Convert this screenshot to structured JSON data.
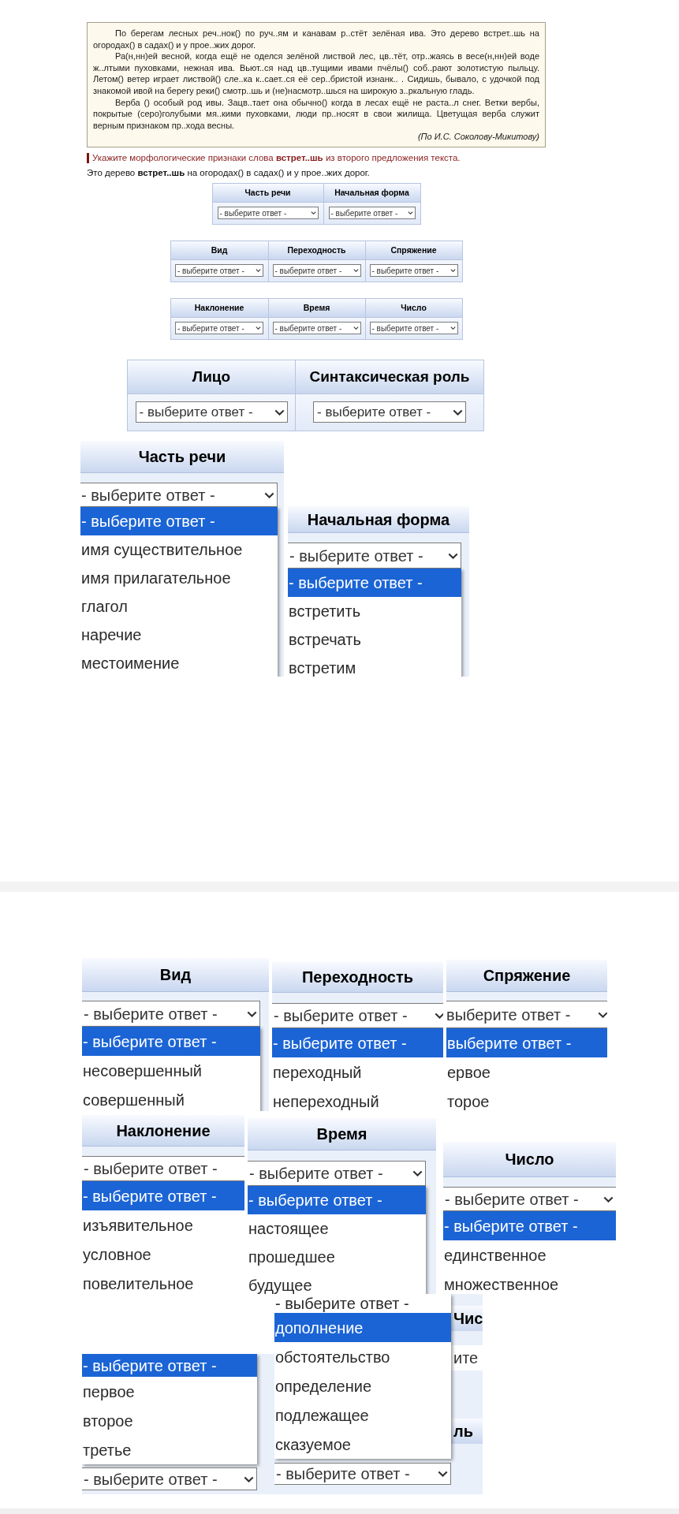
{
  "passage": {
    "paragraphs": [
      "По берегам лесных реч..нок() по руч..ям и канавам р..стёт зелёная ива. Это дерево встрет..шь на огородах() в садах() и у прое..жих дорог.",
      "Ра(н,нн)ей весной, когда ещё не оделся зелёной листвой лес, цв..тёт, отр..жаясь в весе(н,нн)ей воде ж..лтыми пуховками, нежная ива. Вьют..ся над цв..тущими ивами пчёлы() соб..рают золотистую пыльцу. Летом() ветер играет листвой() сле..ка к..сает..ся её сер..бристой изнанк.. . Сидишь, бывало, с удочкой под знакомой ивой на берегу реки() смотр..шь и (не)насмотр..шься на широкую з..ркальную гладь.",
      "Верба () особый род ивы. Зацв..тает она обычно() когда в лесах ещё не раста..л снег. Ветки вербы, покрытые (серо)голубыми мя..кими пуховками, люди пр..носят в свои жилища. Цветущая верба служит верным признаком пр..хода весны."
    ],
    "source": "(По И.С. Соколову-Микитову)"
  },
  "task": {
    "prompt": "Укажите морфологические признаки слова **встрет..шь** из второго предложения текста.",
    "sentence": "Это дерево **встрет..шь** на огородах() в садах() и у прое..жих дорог."
  },
  "answer_tables": [
    {
      "columns": [
        {
          "header": "Часть речи",
          "select": "- выберите ответ -"
        },
        {
          "header": "Начальная форма",
          "select": "- выберите ответ -"
        }
      ]
    },
    {
      "columns": [
        {
          "header": "Вид",
          "select": "- выберите ответ -"
        },
        {
          "header": "Переходность",
          "select": "- выберите ответ -"
        },
        {
          "header": "Спряжение",
          "select": "- выберите ответ -"
        }
      ]
    },
    {
      "columns": [
        {
          "header": "Наклонение",
          "select": "- выберите ответ -"
        },
        {
          "header": "Время",
          "select": "- выберите ответ -"
        },
        {
          "header": "Число",
          "select": "- выберите ответ -"
        }
      ]
    }
  ],
  "zoomed_table": {
    "columns": [
      {
        "header": "Лицо",
        "select": "- выберите ответ -"
      },
      {
        "header": "Синтаксическая роль",
        "select": "- выберите ответ -"
      }
    ]
  },
  "dropdown_fragments": [
    {
      "kind": "down",
      "header": "Часть речи",
      "select": "- выберите ответ -",
      "options": [
        {
          "label": "- выберите ответ -",
          "selected": true
        },
        {
          "label": "имя существительное",
          "selected": false
        },
        {
          "label": "имя прилагательное",
          "selected": false
        },
        {
          "label": "глагол",
          "selected": false
        },
        {
          "label": "наречие",
          "selected": false
        },
        {
          "label": "местоимение",
          "selected": false
        }
      ]
    },
    {
      "kind": "down",
      "header": "Начальная форма",
      "select": "- выберите ответ -",
      "options": [
        {
          "label": "- выберите ответ -",
          "selected": true
        },
        {
          "label": "встретить",
          "selected": false
        },
        {
          "label": "встречать",
          "selected": false
        },
        {
          "label": "встретим",
          "selected": false
        }
      ]
    },
    {
      "kind": "down",
      "header": "Вид",
      "select": "- выберите ответ -",
      "options": [
        {
          "label": "- выберите ответ -",
          "selected": true
        },
        {
          "label": "несовершенный",
          "selected": false
        },
        {
          "label": "совершенный",
          "selected": false
        }
      ]
    },
    {
      "kind": "down",
      "header": "Переходность",
      "select": "- выберите ответ -",
      "options": [
        {
          "label": "- выберите ответ -",
          "selected": true
        },
        {
          "label": "переходный",
          "selected": false
        },
        {
          "label": "непереходный",
          "selected": false
        }
      ]
    },
    {
      "kind": "down",
      "header": "Спряжение",
      "select": "выберите ответ -",
      "options": [
        {
          "label": "выберите ответ -",
          "selected": true
        },
        {
          "label": "ервое",
          "selected": false
        },
        {
          "label": "торое",
          "selected": false
        }
      ]
    },
    {
      "kind": "down",
      "header": "Наклонение",
      "select": "- выберите ответ -",
      "options": [
        {
          "label": "- выберите ответ -",
          "selected": true
        },
        {
          "label": "изъявительное",
          "selected": false
        },
        {
          "label": "условное",
          "selected": false
        },
        {
          "label": "повелительное",
          "selected": false
        }
      ]
    },
    {
      "kind": "down",
      "header": "Время",
      "select": "- выберите ответ -",
      "options": [
        {
          "label": "- выберите ответ -",
          "selected": true
        },
        {
          "label": "настоящее",
          "selected": false
        },
        {
          "label": "прошедшее",
          "selected": false
        },
        {
          "label": "будущее",
          "selected": false
        }
      ]
    },
    {
      "kind": "down",
      "header": "Число",
      "select": "- выберите ответ -",
      "options": [
        {
          "label": "- выберите ответ -",
          "selected": true
        },
        {
          "label": "единственное",
          "selected": false
        },
        {
          "label": "множественное",
          "selected": false
        }
      ]
    },
    {
      "kind": "up",
      "select": "- выберите ответ -",
      "options": [
        {
          "label": "- выберите ответ -",
          "selected": true
        },
        {
          "label": "первое",
          "selected": false
        },
        {
          "label": "второе",
          "selected": false
        },
        {
          "label": "третье",
          "selected": false
        }
      ]
    },
    {
      "kind": "up",
      "select": "- выберите ответ -",
      "options": [
        {
          "label": "- выберите ответ -",
          "selected": false
        },
        {
          "label": "дополнение",
          "selected": true
        },
        {
          "label": "обстоятельство",
          "selected": false
        },
        {
          "label": "определение",
          "selected": false
        },
        {
          "label": "подлежащее",
          "selected": false
        },
        {
          "label": "сказуемое",
          "selected": false
        }
      ],
      "behind": [
        {
          "text": "Чис",
          "kind": "header"
        },
        {
          "text": "ите",
          "kind": "cell"
        },
        {
          "text": "ль",
          "kind": "header"
        }
      ]
    }
  ]
}
